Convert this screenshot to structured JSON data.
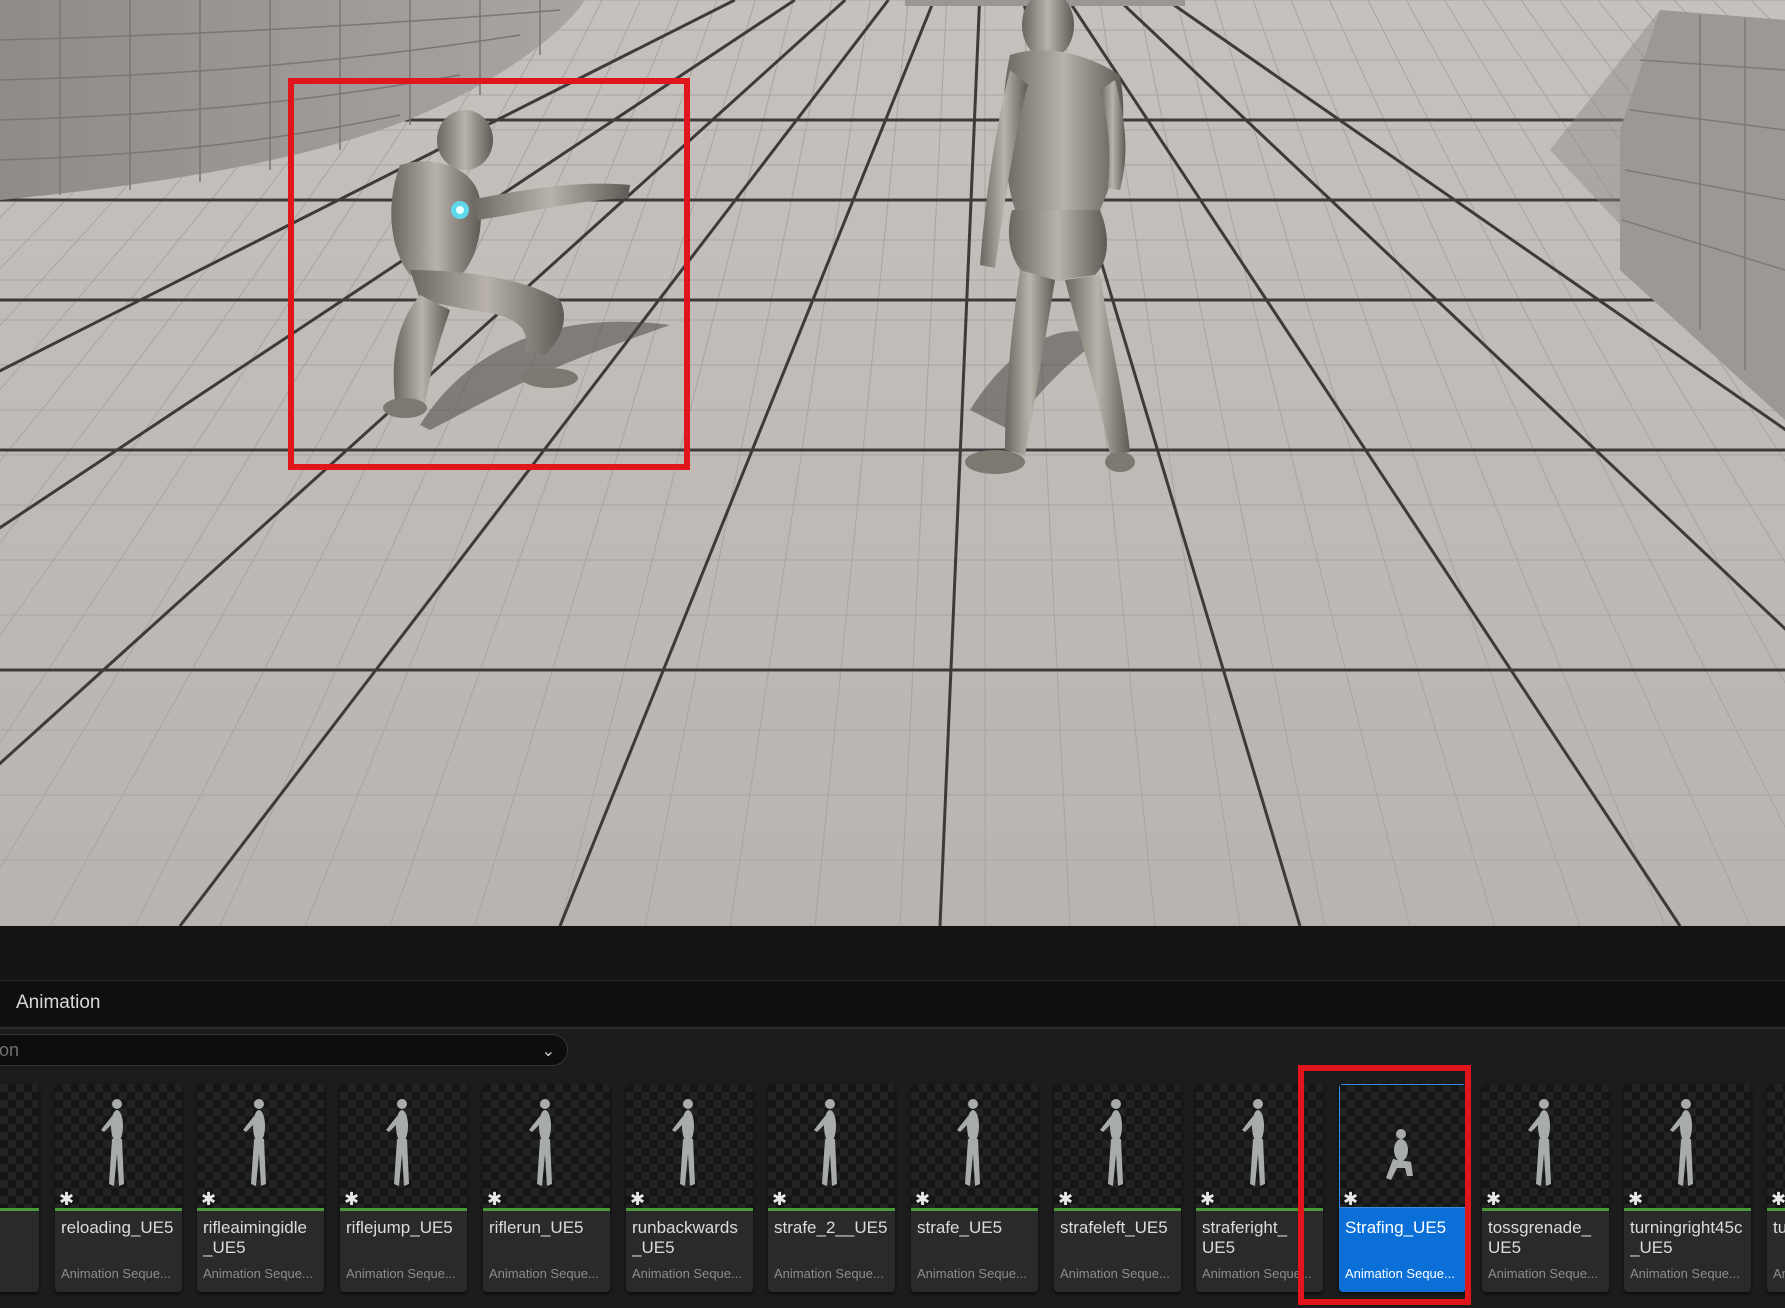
{
  "panel": {
    "title": "Animation",
    "filter_value": "on"
  },
  "assets": [
    {
      "name": "",
      "type": "ue..."
    },
    {
      "name": "reloading_UE5",
      "type": "Animation Seque..."
    },
    {
      "name": "rifleaimingidle\n_UE5",
      "type": "Animation Seque..."
    },
    {
      "name": "riflejump_UE5",
      "type": "Animation Seque..."
    },
    {
      "name": "riflerun_UE5",
      "type": "Animation Seque..."
    },
    {
      "name": "runbackwards\n_UE5",
      "type": "Animation Seque..."
    },
    {
      "name": "strafe_2__UE5",
      "type": "Animation Seque..."
    },
    {
      "name": "strafe_UE5",
      "type": "Animation Seque..."
    },
    {
      "name": "strafeleft_UE5",
      "type": "Animation Seque..."
    },
    {
      "name": "straferight_\nUE5",
      "type": "Animation Seque..."
    },
    {
      "name": "Strafing_UE5",
      "type": "Animation Seque...",
      "selected": true
    },
    {
      "name": "tossgrenade_\nUE5",
      "type": "Animation Seque..."
    },
    {
      "name": "turningright45c\n_UE5",
      "type": "Animation Seque..."
    },
    {
      "name": "turn",
      "type": "Anim"
    }
  ],
  "icons": {
    "favorite": "star-icon",
    "dropdown": "chevron-down-icon"
  },
  "colors": {
    "highlight": "#e0161c",
    "selection": "#0a70d8",
    "asset_bar": "#4a9a3a"
  }
}
